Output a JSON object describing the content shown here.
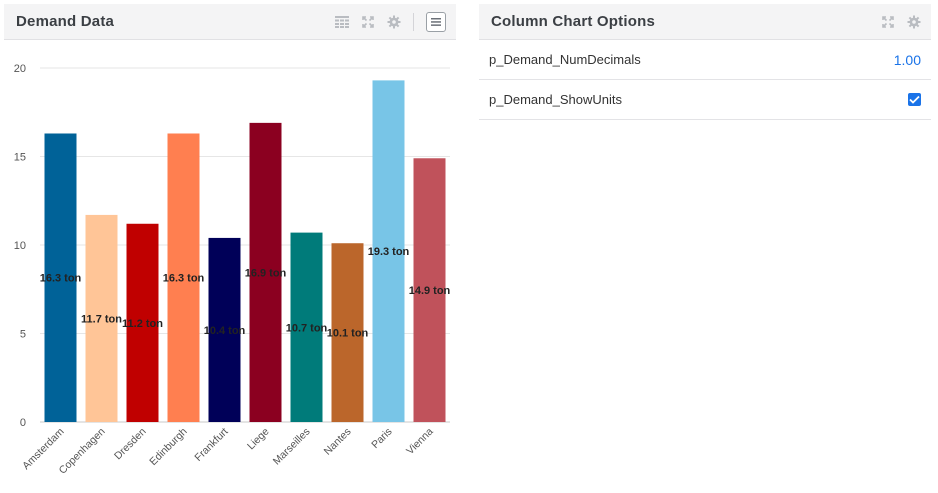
{
  "left_panel": {
    "title": "Demand Data",
    "icons": [
      "table-icon",
      "expand-icon",
      "gear-icon",
      "menu-icon"
    ]
  },
  "right_panel": {
    "title": "Column Chart Options",
    "icons": [
      "expand-icon",
      "gear-icon"
    ],
    "options": [
      {
        "label": "p_Demand_NumDecimals",
        "value": "1.00"
      },
      {
        "label": "p_Demand_ShowUnits",
        "checked": true
      }
    ]
  },
  "chart_data": {
    "type": "bar",
    "categories": [
      "Amsterdam",
      "Copenhagen",
      "Dresden",
      "Edinburgh",
      "Frankfurt",
      "Liege",
      "Marseilles",
      "Nantes",
      "Paris",
      "Vienna"
    ],
    "values": [
      16.3,
      11.7,
      11.2,
      16.3,
      10.4,
      16.9,
      10.7,
      10.1,
      19.3,
      14.9
    ],
    "data_labels": [
      "16.3 ton",
      "11.7 ton",
      "11.2 ton",
      "16.3 ton",
      "10.4 ton",
      "16.9 ton",
      "10.7 ton",
      "10.1 ton",
      "19.3 ton",
      "14.9 ton"
    ],
    "colors": [
      "#006298",
      "#ffc597",
      "#c00000",
      "#ff7f50",
      "#000058",
      "#8b0020",
      "#007b7a",
      "#bb662b",
      "#78c5e7",
      "#c0525b"
    ],
    "yticks": [
      "0",
      "5",
      "10",
      "15",
      "20"
    ],
    "ylim": [
      0,
      20
    ],
    "grid": true,
    "title": "",
    "xlabel": "",
    "ylabel": ""
  }
}
